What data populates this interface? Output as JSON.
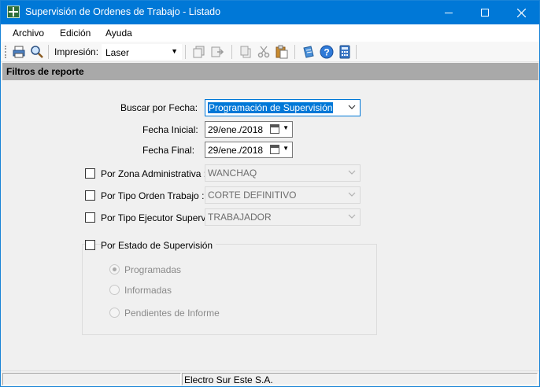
{
  "window": {
    "title": "Supervisión de Ordenes de Trabajo - Listado",
    "controls": {
      "minimize": "minimize-icon",
      "maximize": "maximize-icon",
      "close": "close-icon"
    }
  },
  "menu": {
    "items": [
      "Archivo",
      "Edición",
      "Ayuda"
    ]
  },
  "toolbar": {
    "print_label": "Impresión:",
    "printer_value": "Laser",
    "icons": [
      "print-icon",
      "preview-icon",
      "copy-page-icon",
      "export-icon",
      "copy-icon",
      "cut-icon",
      "paste-icon",
      "notes-icon",
      "help-icon",
      "calculator-icon"
    ]
  },
  "section": {
    "title": "Filtros de reporte"
  },
  "filters": {
    "search_by_date_label": "Buscar por Fecha:",
    "search_by_date_value": "Programación de Supervisión",
    "start_date_label": "Fecha Inicial:",
    "start_date_value": "29/ene./2018",
    "end_date_label": "Fecha Final:",
    "end_date_value": "29/ene./2018",
    "zone_label": "Por Zona Administrativa :",
    "zone_value": "WANCHAQ",
    "order_type_label": "Por Tipo Orden Trabajo :",
    "order_type_value": "CORTE DEFINITIVO",
    "executor_label": "Por Tipo Ejecutor Superv. :",
    "executor_value": "TRABAJADOR",
    "status_label": "Por Estado de Supervisión",
    "status_options": [
      "Programadas",
      "Informadas",
      "Pendientes de Informe"
    ],
    "status_selected": "Programadas"
  },
  "status_bar": {
    "left": "",
    "company": "Electro Sur Este S.A."
  },
  "colors": {
    "titlebar": "#0078d7",
    "section_header": "#a9a9a9",
    "selection": "#0078d7"
  }
}
